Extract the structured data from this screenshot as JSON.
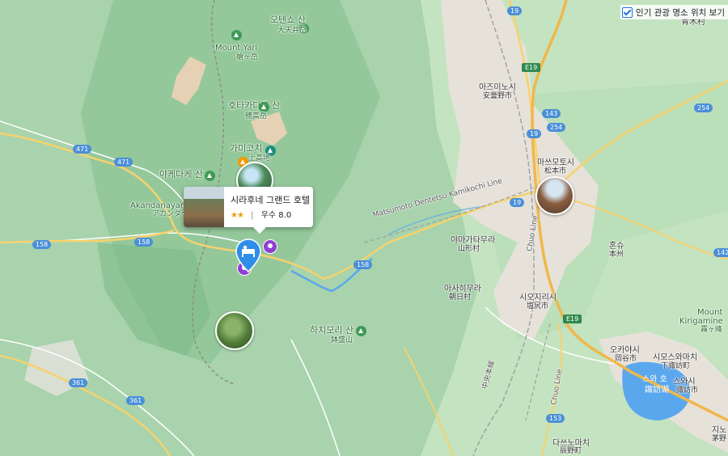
{
  "layer_toggle": {
    "label": "인기 관광 명소 위치 보기",
    "checked": true
  },
  "hotel_card": {
    "name": "시라후네 그랜드 호텔",
    "stars": "★★",
    "separator": "|",
    "rating_word": "우수",
    "rating_value": "8.0"
  },
  "places": {
    "aoki": "青木村",
    "otensho_ko": "오텐쇼 산",
    "otensho_ja": "大天井岳",
    "yari_en": "Mount Yari",
    "yari_ja": "槍ヶ岳",
    "hotaka_ko": "호타카다케 산",
    "hotaka_ja": "穂高岳",
    "kamikochi_ko": "가미코치",
    "kamikochi_ja": "上高地",
    "yake_ko": "야케다케 산",
    "akandanayama": "Akandanayam",
    "akandanayama_ja": "アカンダナ",
    "azumino_ko": "아즈미노시",
    "azumino_ja": "安曇野市",
    "matsumoto_ko": "마쓰모토시",
    "matsumoto_ja": "松本市",
    "yamagata_ko": "야마가타무라",
    "yamagata_ja": "山形村",
    "asahi_ko": "아사히무라",
    "asahi_ja": "朝日村",
    "shiojiri_ko": "시오지리시",
    "shiojiri_ja": "塩尻市",
    "hachimori_ko": "하치모리 산",
    "hachimori_ja": "鉢盛山",
    "honshu_ko": "혼슈",
    "honshu_ja": "本州",
    "kirigamine_en": "Mount",
    "kirigamine_en2": "Kirigamine",
    "kirigamine_ja": "霧ヶ峰",
    "okaya_ko": "오카야시",
    "okaya_ja": "岡谷市",
    "shimosuwa_ko": "시모스와마치",
    "shimosuwa_ja": "下諏訪町",
    "suwa_lake_ko": "스와 호",
    "suwa_lake_ja": "諏訪湖",
    "suwa_ko": "스와시",
    "suwa_ja": "諏訪市",
    "tatsuno_ko": "다쓰노마치",
    "tatsuno_ja": "辰野町",
    "chino_ko": "지노",
    "chino_ja": "茅野",
    "railway": "Matsumoto Dentetsu Kamikochi Line",
    "chuo_line": "Chuo Line",
    "chuo_line_jp": "中央本線"
  },
  "routes": [
    "19",
    "471",
    "471",
    "158",
    "158",
    "158",
    "E19",
    "143",
    "254",
    "254",
    "19",
    "361",
    "361",
    "153",
    "E19",
    "19",
    "142"
  ],
  "colors": {
    "terrain": "#a8d3ac",
    "valley": "#c4e3c0",
    "urban": "#e6e2da",
    "road": "#f6d26d",
    "expressway": "#f0b74a",
    "water": "#5aa7ee",
    "pin": "#2f8ee8",
    "poi": "#8f3fd1"
  }
}
